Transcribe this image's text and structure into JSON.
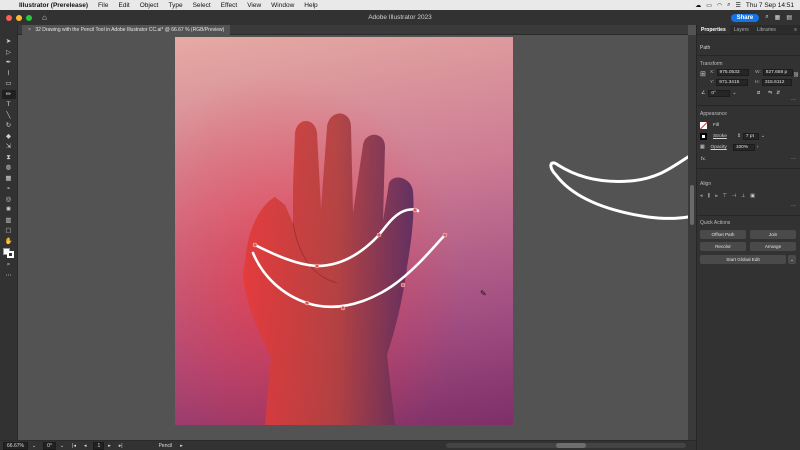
{
  "menubar": {
    "items": [
      "Illustrator (Prerelease)",
      "File",
      "Edit",
      "Object",
      "Type",
      "Select",
      "Effect",
      "View",
      "Window",
      "Help"
    ],
    "clock": "Thu 7 Sep 14:51"
  },
  "appbar": {
    "title": "Adobe Illustrator 2023",
    "share_label": "Share",
    "traffic_colors": [
      "#ff5f57",
      "#febc2e",
      "#28c840"
    ]
  },
  "document": {
    "tab_label": "32 Drawing with the Pencil Tool in Adobe Illustrator CC.ai* @ 66.67 % (RGB/Preview)"
  },
  "toolbar": {
    "tools": [
      {
        "name": "selection-tool",
        "glyph": "➤"
      },
      {
        "name": "direct-selection-tool",
        "glyph": "▷"
      },
      {
        "name": "pen-tool",
        "glyph": "✒"
      },
      {
        "name": "curvature-tool",
        "glyph": "⌇"
      },
      {
        "name": "rectangle-tool",
        "glyph": "▭"
      },
      {
        "name": "pencil-tool",
        "glyph": "✏",
        "active": true
      },
      {
        "name": "type-tool",
        "glyph": "T"
      },
      {
        "name": "line-tool",
        "glyph": "╲"
      },
      {
        "name": "rotate-tool",
        "glyph": "↻"
      },
      {
        "name": "eraser-tool",
        "glyph": "◆"
      },
      {
        "name": "scale-tool",
        "glyph": "⇲"
      },
      {
        "name": "width-tool",
        "glyph": "⧗"
      },
      {
        "name": "shape-builder-tool",
        "glyph": "◍"
      },
      {
        "name": "gradient-tool",
        "glyph": "▦"
      },
      {
        "name": "eyedropper-tool",
        "glyph": "⌁"
      },
      {
        "name": "blend-tool",
        "glyph": "◎"
      },
      {
        "name": "symbol-sprayer-tool",
        "glyph": "✺"
      },
      {
        "name": "graph-tool",
        "glyph": "▥"
      },
      {
        "name": "artboard-tool",
        "glyph": "▢"
      },
      {
        "name": "hand-tool",
        "glyph": "✋"
      },
      {
        "name": "zoom-tool",
        "glyph": "⌕"
      }
    ],
    "more_glyph": "⋯"
  },
  "status": {
    "zoom": "66.67%",
    "rotation": "0°",
    "artboard": "1",
    "tool": "Pencil"
  },
  "panel": {
    "tabs": [
      "Properties",
      "Layers",
      "Libraries"
    ],
    "object_type": "Path",
    "transform": {
      "title": "Transform",
      "x_label": "X:",
      "x": "975.0533",
      "y_label": "Y:",
      "y": "971.3415",
      "w_label": "W:",
      "w": "827.658 p",
      "h_label": "H:",
      "h": "315.6112",
      "angle": "0°"
    },
    "appearance": {
      "title": "Appearance",
      "fill_label": "Fill",
      "stroke_label": "Stroke",
      "stroke_value": "7 pt",
      "opacity_label": "Opacity",
      "opacity_value": "100%",
      "fx_label": "fx."
    },
    "align": {
      "title": "Align"
    },
    "quick_actions": {
      "title": "Quick Actions",
      "offset_path": "Offset Path",
      "join": "Join",
      "recolor": "Recolor",
      "arrange": "Arrange",
      "start_global_edit": "Start Global Edit"
    }
  },
  "colors": {
    "accent": "#1473e6",
    "anchor": "#e05a5a",
    "path": "#ffffff"
  }
}
